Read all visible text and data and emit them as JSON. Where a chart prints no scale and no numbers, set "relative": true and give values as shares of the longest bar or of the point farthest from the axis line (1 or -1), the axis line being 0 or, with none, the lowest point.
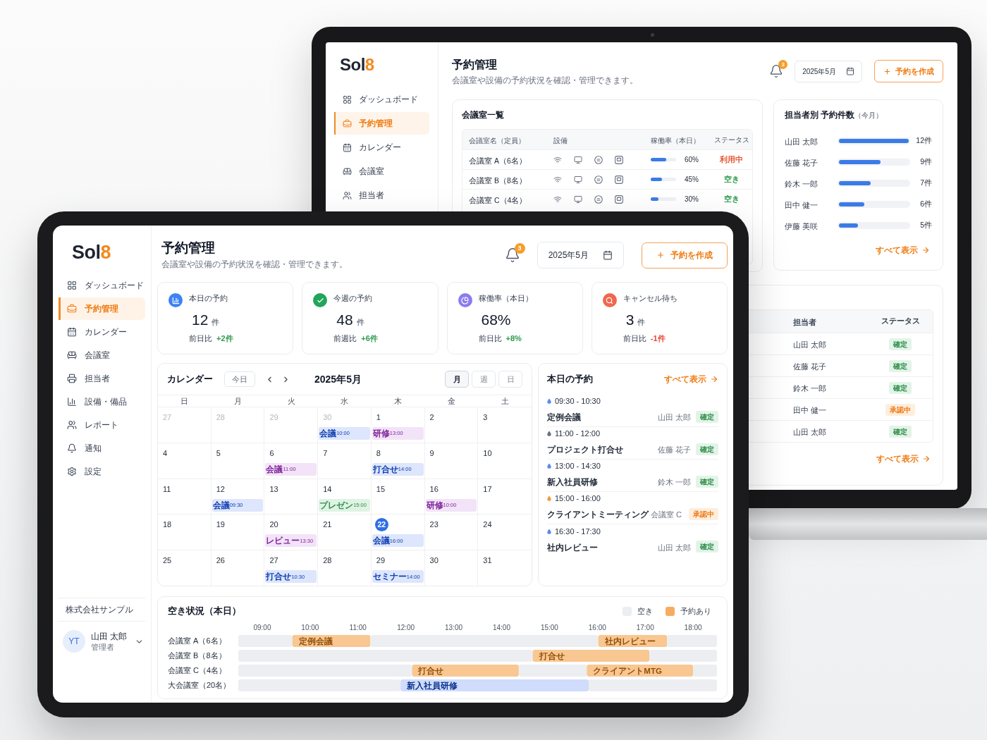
{
  "laptop": {
    "sidebar": {
      "logo": {
        "text": "Sol",
        "accent": "8"
      },
      "items": [
        {
          "label": "ダッシュボード",
          "selected": false
        },
        {
          "label": "予約管理",
          "selected": true
        },
        {
          "label": "カレンダー",
          "selected": false
        },
        {
          "label": "会議室",
          "selected": false
        },
        {
          "label": "担当者",
          "selected": false
        }
      ]
    },
    "header": {
      "title": "予約管理",
      "subtitle": "会議室や設備の予約状況を確認・管理できます。",
      "notification_count": "3",
      "month": "2025年5月",
      "create_button": "予約を作成"
    },
    "rooms": {
      "title": "会議室一覧",
      "columns": [
        "会議室名（定員）",
        "設備",
        "稼働率（本日）",
        "ステータス"
      ],
      "rows": [
        {
          "name": "会議室 A（6名）",
          "level": 0.6,
          "rate": "60%",
          "status": "利用中",
          "in_use": true
        },
        {
          "name": "会議室 B（8名）",
          "level": 0.45,
          "rate": "45%",
          "status": "空き",
          "in_use": false
        },
        {
          "name": "会議室 C（4名）",
          "level": 0.3,
          "rate": "30%",
          "status": "空き",
          "in_use": false
        }
      ]
    },
    "staff_counts": {
      "title": "担当者別 予約件数",
      "note": "（今月）",
      "rows": [
        {
          "name": "山田 太郎",
          "level": 1.0,
          "count": "12件"
        },
        {
          "name": "佐藤 花子",
          "level": 0.6,
          "count": "9件"
        },
        {
          "name": "鈴木 一郎",
          "level": 0.45,
          "count": "7件"
        },
        {
          "name": "田中 健一",
          "level": 0.36,
          "count": "6件"
        },
        {
          "name": "伊藤 美咲",
          "level": 0.27,
          "count": "5件"
        }
      ],
      "link": "すべて表示"
    },
    "reservations": {
      "columns": [
        "担当者",
        "ステータス"
      ],
      "rows": [
        {
          "person": "山田 太郎",
          "status": "確定",
          "pending": false
        },
        {
          "person": "佐藤 花子",
          "status": "確定",
          "pending": false
        },
        {
          "person": "鈴木 一郎",
          "status": "確定",
          "pending": false
        },
        {
          "person": "田中 健一",
          "status": "承認中",
          "pending": true
        },
        {
          "person": "山田 太郎",
          "status": "確定",
          "pending": false
        }
      ],
      "link": "すべて表示"
    }
  },
  "tablet": {
    "sidebar": {
      "logo": {
        "text": "Sol",
        "accent": "8"
      },
      "items": [
        {
          "label": "ダッシュボード",
          "selected": false
        },
        {
          "label": "予約管理",
          "selected": true
        },
        {
          "label": "カレンダー",
          "selected": false
        },
        {
          "label": "会議室",
          "selected": false
        },
        {
          "label": "担当者",
          "selected": false
        },
        {
          "label": "設備・備品",
          "selected": false
        },
        {
          "label": "レポート",
          "selected": false
        },
        {
          "label": "通知",
          "selected": false
        },
        {
          "label": "設定",
          "selected": false
        }
      ],
      "company": "株式会社サンプル",
      "user": {
        "initials": "YT",
        "name": "山田 太郎",
        "role": "管理者"
      }
    },
    "header": {
      "title": "予約管理",
      "subtitle": "会議室や設備の予約状況を確認・管理できます。",
      "notification_count": "3",
      "month": "2025年5月",
      "create_button": "予約を作成"
    },
    "stats": [
      {
        "label": "本日の予約",
        "value": "12",
        "unit": "件",
        "compare": "前日比",
        "delta": "+2件",
        "negative": false,
        "color": "#3b82f6"
      },
      {
        "label": "今週の予約",
        "value": "48",
        "unit": "件",
        "compare": "前週比",
        "delta": "+6件",
        "negative": false,
        "color": "#22a55a"
      },
      {
        "label": "稼働率（本日）",
        "value": "68%",
        "compare": "前日比",
        "delta": "+8%",
        "negative": false,
        "color": "#8b7cf0"
      },
      {
        "label": "キャンセル待ち",
        "value": "3",
        "unit": "件",
        "compare": "前日比",
        "delta": "-1件",
        "negative": true,
        "color": "#f0674f"
      }
    ],
    "calendar": {
      "title": "カレンダー",
      "today_button": "今日",
      "month": "2025年5月",
      "views": [
        {
          "label": "月",
          "selected": true
        },
        {
          "label": "週",
          "selected": false
        },
        {
          "label": "日",
          "selected": false
        }
      ],
      "weekdays": [
        "日",
        "月",
        "火",
        "水",
        "木",
        "金",
        "土"
      ],
      "weeks": [
        [
          {
            "day": "27",
            "muted": true,
            "today": false
          },
          {
            "day": "28",
            "muted": true,
            "today": false
          },
          {
            "day": "29",
            "muted": true,
            "today": false
          },
          {
            "day": "30",
            "muted": true,
            "today": false,
            "events": [
              {
                "label": "会議",
                "time": "10:00",
                "color": "#dde6fc"
              }
            ]
          },
          {
            "day": "1",
            "muted": false,
            "today": false,
            "events": [
              {
                "label": "研修",
                "time": "13:00",
                "color": "#f3e3f8"
              }
            ]
          },
          {
            "day": "2",
            "muted": false,
            "today": false
          },
          {
            "day": "3",
            "muted": false,
            "today": false
          }
        ],
        [
          {
            "day": "4",
            "muted": false,
            "today": false
          },
          {
            "day": "5",
            "muted": false,
            "today": false
          },
          {
            "day": "6",
            "muted": false,
            "today": false,
            "events": [
              {
                "label": "会議",
                "time": "11:00",
                "color": "#f3e3f8"
              }
            ]
          },
          {
            "day": "7",
            "muted": false,
            "today": false
          },
          {
            "day": "8",
            "muted": false,
            "today": false,
            "events": [
              {
                "label": "打合せ",
                "time": "14:00",
                "color": "#dde6fc"
              }
            ]
          },
          {
            "day": "9",
            "muted": false,
            "today": false
          },
          {
            "day": "10",
            "muted": false,
            "today": false
          }
        ],
        [
          {
            "day": "11",
            "muted": false,
            "today": false
          },
          {
            "day": "12",
            "muted": false,
            "today": false,
            "events": [
              {
                "label": "会議",
                "time": "09:30",
                "color": "#dde6fc"
              }
            ]
          },
          {
            "day": "13",
            "muted": false,
            "today": false
          },
          {
            "day": "14",
            "muted": false,
            "today": false,
            "events": [
              {
                "label": "プレゼン",
                "time": "15:00",
                "color": "#dff3e4"
              }
            ]
          },
          {
            "day": "15",
            "muted": false,
            "today": false
          },
          {
            "day": "16",
            "muted": false,
            "today": false,
            "events": [
              {
                "label": "研修",
                "time": "10:00",
                "color": "#f3e3f8"
              }
            ]
          },
          {
            "day": "17",
            "muted": false,
            "today": false
          }
        ],
        [
          {
            "day": "18",
            "muted": false,
            "today": false
          },
          {
            "day": "19",
            "muted": false,
            "today": false
          },
          {
            "day": "20",
            "muted": false,
            "today": false,
            "events": [
              {
                "label": "レビュー",
                "time": "13:30",
                "color": "#f3e3f8"
              }
            ]
          },
          {
            "day": "21",
            "muted": false,
            "today": false
          },
          {
            "day": "22",
            "muted": false,
            "today": true,
            "events": [
              {
                "label": "会議",
                "time": "16:00",
                "color": "#dde6fc"
              }
            ]
          },
          {
            "day": "23",
            "muted": false,
            "today": false
          },
          {
            "day": "24",
            "muted": false,
            "today": false
          }
        ],
        [
          {
            "day": "25",
            "muted": false,
            "today": false
          },
          {
            "day": "26",
            "muted": false,
            "today": false
          },
          {
            "day": "27",
            "muted": false,
            "today": false,
            "events": [
              {
                "label": "打合せ",
                "time": "10:30",
                "color": "#dde6fc"
              }
            ]
          },
          {
            "day": "28",
            "muted": false,
            "today": false
          },
          {
            "day": "29",
            "muted": false,
            "today": false,
            "events": [
              {
                "label": "セミナー",
                "time": "14:00",
                "color": "#dde6fc"
              }
            ]
          },
          {
            "day": "30",
            "muted": false,
            "today": false
          },
          {
            "day": "31",
            "muted": false,
            "today": false
          }
        ]
      ]
    },
    "today": {
      "title": "本日の予約",
      "link": "すべて表示",
      "items": [
        {
          "time": "09:30 - 10:30",
          "title": "定例会議",
          "person": "山田 太郎",
          "status": "確定",
          "pending": false,
          "color": "#5b8def"
        },
        {
          "time": "11:00 - 12:00",
          "title": "プロジェクト打合せ",
          "person": "佐藤 花子",
          "status": "確定",
          "pending": false,
          "color": "#6b7280"
        },
        {
          "time": "13:00 - 14:30",
          "title": "新入社員研修",
          "person": "鈴木 一郎",
          "status": "確定",
          "pending": false,
          "color": "#5b8def"
        },
        {
          "time": "15:00 - 16:00",
          "title": "クライアントミーティング",
          "person": "会議室 C",
          "status": "承認中",
          "pending": true,
          "color": "#f39a3d"
        },
        {
          "time": "16:30 - 17:30",
          "title": "社内レビュー",
          "person": "山田 太郎",
          "status": "確定",
          "pending": false,
          "color": "#5b8def"
        }
      ]
    },
    "availability": {
      "title": "空き状況（本日）",
      "legend": [
        {
          "label": "空き",
          "color": "#eceef1"
        },
        {
          "label": "予約あり",
          "color": "#f6ad62"
        }
      ],
      "time_labels": [
        "09:00",
        "10:00",
        "11:00",
        "12:00",
        "13:00",
        "14:00",
        "15:00",
        "16:00",
        "17:00",
        "18:00"
      ],
      "chart_data": {
        "type": "bar",
        "orientation": "horizontal",
        "stacked": true,
        "relative": true,
        "categories": [
          "会議室 A（6名）",
          "会議室 B（8名）",
          "会議室 C（4名）",
          "大会議室（20名）"
        ],
        "series": [
          {
            "color": "#eceef1",
            "values": [
              0.113,
              0.615,
              0.363,
              0.339
            ]
          },
          {
            "color": "#f9c792",
            "values": [
              0.163,
              0.244,
              0.223,
              null
            ]
          },
          {
            "color": "#cfdcfb",
            "values": [
              null,
              null,
              null,
              0.393
            ]
          },
          {
            "color": "#eceef1",
            "values": [
              0.476,
              0.141,
              0.142,
              0.268
            ]
          },
          {
            "color": "#f9c792",
            "values": [
              0.144,
              null,
              0.222,
              null
            ]
          },
          {
            "color": "#eceef1",
            "values": [
              0.104,
              null,
              0.05,
              null
            ]
          }
        ],
        "annotations": [
          "定例会議",
          "社内レビュー",
          "打合せ",
          "打合せ",
          "クライアントMTG",
          "新入社員研修"
        ]
      }
    }
  }
}
